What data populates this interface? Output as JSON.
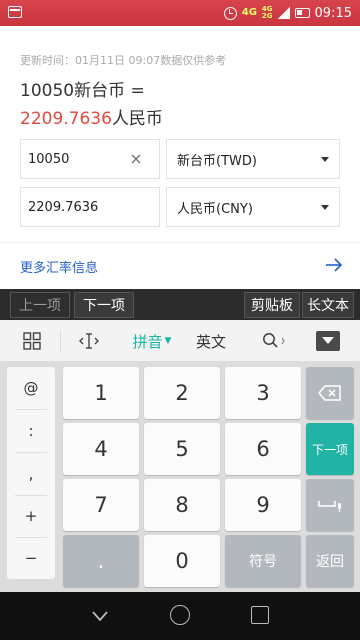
{
  "status_bar": {
    "network_4g": "4G",
    "network_small_top": "4G",
    "network_small_bottom": "2G",
    "time": "09:15"
  },
  "converter": {
    "update_time": "更新时间：01月11日 09:07数据仅供参考",
    "source_line": "10050新台币 =",
    "result_amount": "2209.7636",
    "result_currency": "人民币",
    "input_amount": "10050",
    "output_amount": "2209.7636",
    "source_currency": "新台币(TWD)",
    "target_currency": "人民币(CNY)",
    "more_link": "更多汇率信息"
  },
  "keyboard_toolbar": {
    "prev": "上一项",
    "next": "下一项",
    "clipboard": "剪贴板",
    "long_text": "长文本"
  },
  "ime_bar": {
    "pinyin": "拼音",
    "english": "英文"
  },
  "symbols": [
    "@",
    ":",
    ",",
    "+",
    "−"
  ],
  "keys": {
    "row1": [
      "1",
      "2",
      "3"
    ],
    "row2": [
      "4",
      "5",
      "6"
    ],
    "row3": [
      "7",
      "8",
      "9"
    ],
    "dot": ".",
    "zero": "0",
    "symbol": "符号",
    "next_item": "下一项",
    "return": "返回"
  },
  "colors": {
    "status_bar": "#d03c45",
    "accent_teal": "#20b3a6",
    "result_red": "#e2493f",
    "link_blue": "#2460c8"
  }
}
